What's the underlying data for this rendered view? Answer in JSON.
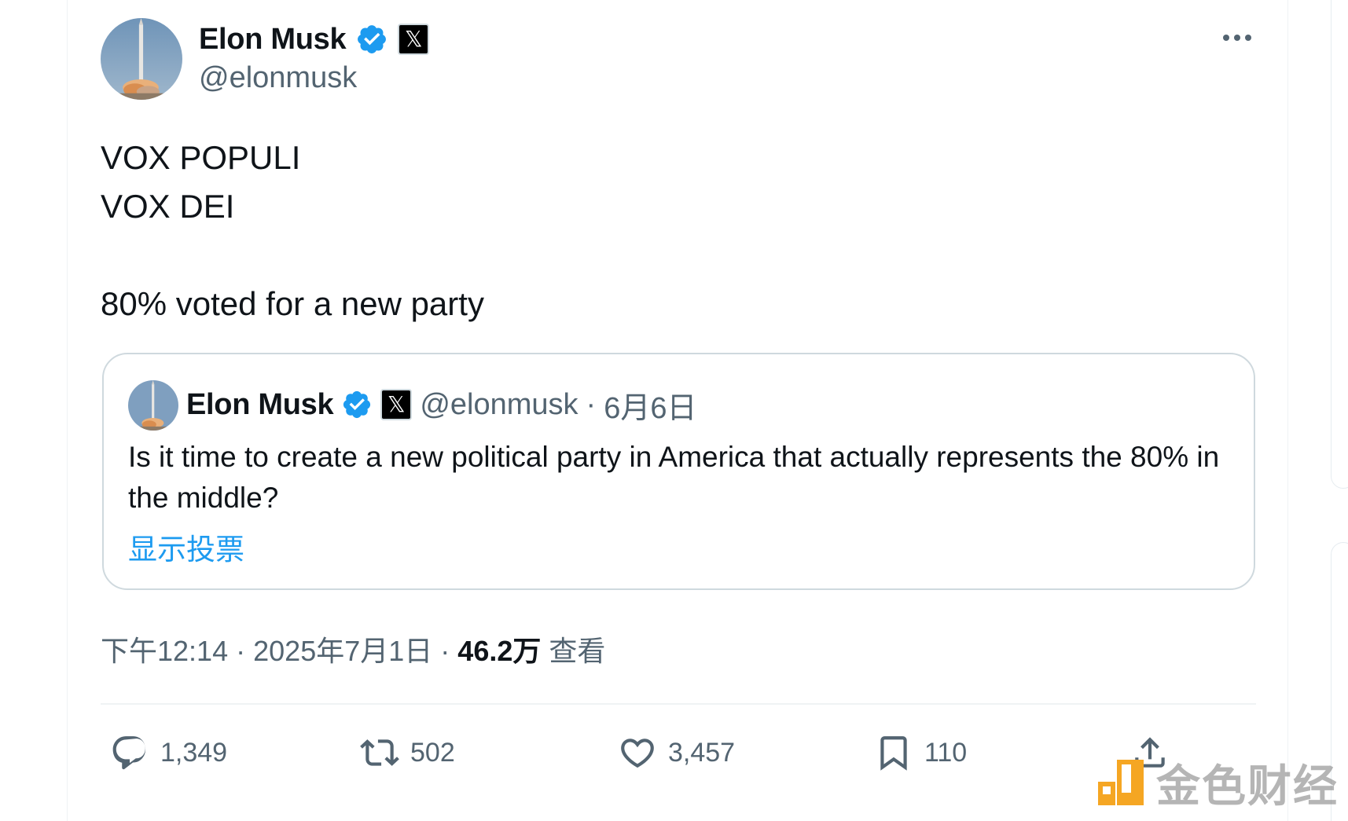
{
  "post": {
    "author_name": "Elon Musk",
    "author_handle": "@elonmusk",
    "verified_color": "#1d9bf0",
    "affiliation_badge_icon": "x-logo-icon",
    "more_icon": "more-horizontal-icon",
    "text_lines": [
      "VOX POPULI",
      "VOX DEI",
      "",
      "80% voted for a new party"
    ]
  },
  "quote": {
    "author_name": "Elon Musk",
    "author_handle": "@elonmusk",
    "separator": "·",
    "date": "6月6日",
    "text": "Is it time to create a new political party in America that actually represents the 80% in the middle?",
    "show_poll_label": "显示投票",
    "link_color": "#1d9bf0"
  },
  "meta": {
    "time": "下午12:14",
    "separator": "·",
    "date": "2025年7月1日",
    "views_count": "46.2万",
    "views_label": "查看"
  },
  "actions": {
    "replies": "1,349",
    "reposts": "502",
    "likes": "3,457",
    "bookmarks": "110"
  },
  "watermark": {
    "text": "金色财经",
    "logo_color": "#f5a623"
  }
}
